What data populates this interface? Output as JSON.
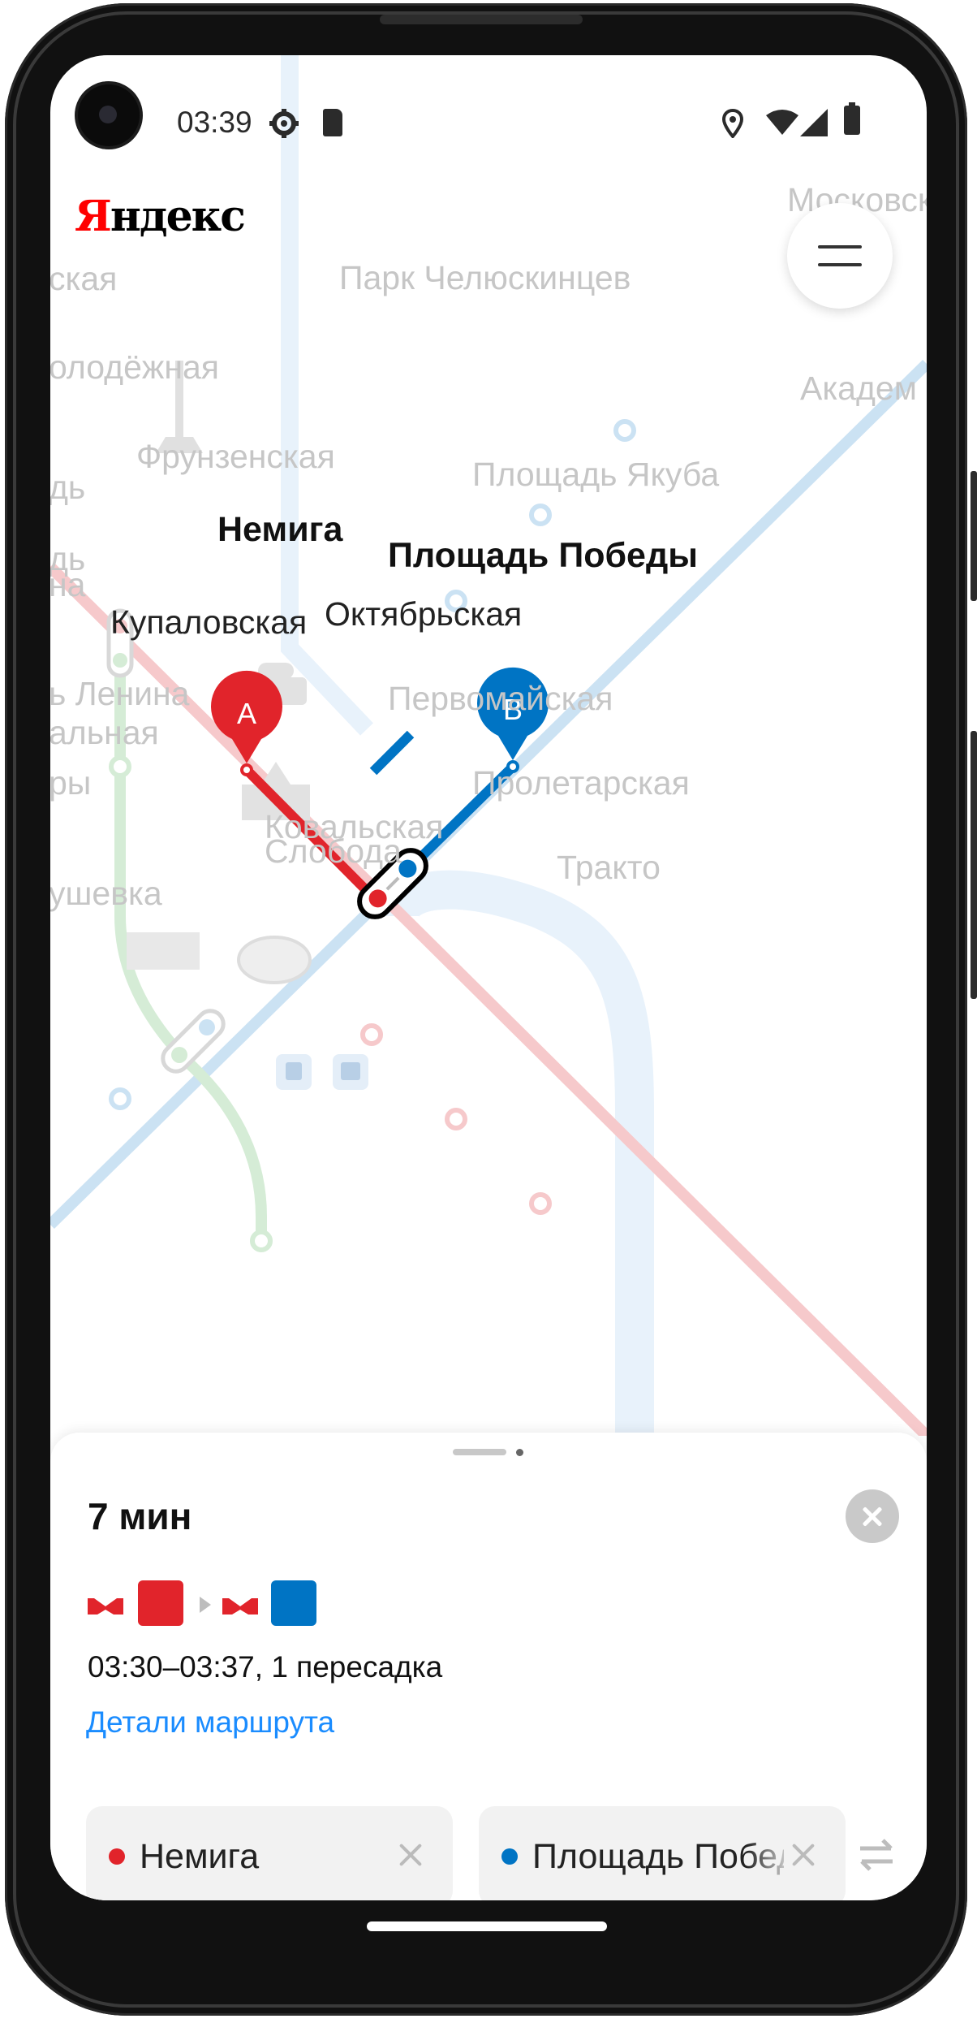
{
  "status_bar": {
    "time": "03:39",
    "icons": [
      "settings-icon",
      "sd-card-icon",
      "location-icon",
      "wifi-icon",
      "signal-icon",
      "battery-icon"
    ]
  },
  "header": {
    "logo_first_letter": "Я",
    "logo_rest": "ндекс"
  },
  "map": {
    "stations_top": [
      {
        "name": "ская"
      },
      {
        "name": "Парк Челюскинцев"
      },
      {
        "name": "Московская"
      }
    ],
    "stations": {
      "molodezhnaya": "олодёжная",
      "akadem": "Академ",
      "frunzenskaya": "Фрунзенская",
      "pl_yakuba": "Площадь Якуба",
      "nemiga": "Немига",
      "pl_pobedy": "Площадь Победы",
      "kupalovskaya": "Купаловская",
      "oktyabrskaya": "Октябрьская",
      "pl_lenina": "ь Ленина",
      "pervomayskaya": "Первомайская",
      "vokzalnaya": "альная",
      "proletarskaya": "Пролетарская",
      "ry": "ры",
      "kovalskaya_1": "Ковальская",
      "kovalskaya_2": "Слобода",
      "traktor": "Тракто",
      "grushevka": "ушевка",
      "left_d": "дь",
      "left_d2": "дь",
      "left_na": "на"
    },
    "marker_a": "A",
    "marker_b": "B",
    "colors": {
      "red_line": "#e1242b",
      "blue_line": "#0074c4",
      "green_line": "#46b450",
      "red_faded": "#f6c9cb",
      "blue_faded": "#cbe2f3",
      "green_faded": "#d5ecd6"
    }
  },
  "route_sheet": {
    "duration": "7 мин",
    "time_range": "03:30–03:37, 1 пересадка",
    "details_link": "Детали маршрута",
    "from_station": "Немига",
    "to_station": "Площадь Победы",
    "from_color": "#e1242b",
    "to_color": "#0074c4"
  }
}
